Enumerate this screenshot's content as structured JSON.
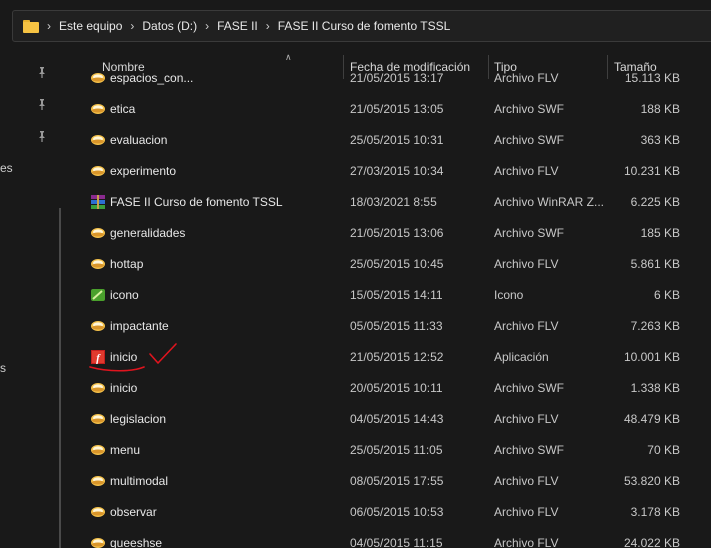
{
  "breadcrumbs": [
    "Este equipo",
    "Datos (D:)",
    "FASE II",
    "FASE II Curso de fomento TSSL"
  ],
  "nav_fragments": [
    "es",
    "s"
  ],
  "columns": {
    "name": "Nombre",
    "modified": "Fecha de modificación",
    "type": "Tipo",
    "size": "Tamaño"
  },
  "files": [
    {
      "name": "espacios_con...",
      "date": "21/05/2015 13:17",
      "type": "Archivo FLV",
      "size": "15.113 KB",
      "icon": "media-file-icon"
    },
    {
      "name": "etica",
      "date": "21/05/2015 13:05",
      "type": "Archivo SWF",
      "size": "188 KB",
      "icon": "media-file-icon"
    },
    {
      "name": "evaluacion",
      "date": "25/05/2015 10:31",
      "type": "Archivo SWF",
      "size": "363 KB",
      "icon": "media-file-icon"
    },
    {
      "name": "experimento",
      "date": "27/03/2015 10:34",
      "type": "Archivo FLV",
      "size": "10.231 KB",
      "icon": "media-file-icon"
    },
    {
      "name": "FASE II Curso de fomento TSSL",
      "date": "18/03/2021 8:55",
      "type": "Archivo WinRAR Z...",
      "size": "6.225 KB",
      "icon": "winrar-icon"
    },
    {
      "name": "generalidades",
      "date": "21/05/2015 13:06",
      "type": "Archivo SWF",
      "size": "185 KB",
      "icon": "media-file-icon"
    },
    {
      "name": "hottap",
      "date": "25/05/2015 10:45",
      "type": "Archivo FLV",
      "size": "5.861 KB",
      "icon": "media-file-icon"
    },
    {
      "name": "icono",
      "date": "15/05/2015 14:11",
      "type": "Icono",
      "size": "6 KB",
      "icon": "icon-file-icon"
    },
    {
      "name": "impactante",
      "date": "05/05/2015 11:33",
      "type": "Archivo FLV",
      "size": "7.263 KB",
      "icon": "media-file-icon"
    },
    {
      "name": "inicio",
      "date": "21/05/2015 12:52",
      "type": "Aplicación",
      "size": "10.001 KB",
      "icon": "flash-app-icon"
    },
    {
      "name": "inicio",
      "date": "20/05/2015 10:11",
      "type": "Archivo SWF",
      "size": "1.338 KB",
      "icon": "media-file-icon"
    },
    {
      "name": "legislacion",
      "date": "04/05/2015 14:43",
      "type": "Archivo FLV",
      "size": "48.479 KB",
      "icon": "media-file-icon"
    },
    {
      "name": "menu",
      "date": "25/05/2015 11:05",
      "type": "Archivo SWF",
      "size": "70 KB",
      "icon": "media-file-icon"
    },
    {
      "name": "multimodal",
      "date": "08/05/2015 17:55",
      "type": "Archivo FLV",
      "size": "53.820 KB",
      "icon": "media-file-icon"
    },
    {
      "name": "observar",
      "date": "06/05/2015 10:53",
      "type": "Archivo FLV",
      "size": "3.178 KB",
      "icon": "media-file-icon"
    },
    {
      "name": "queeshse",
      "date": "04/05/2015 11:15",
      "type": "Archivo FLV",
      "size": "24.022 KB",
      "icon": "media-file-icon"
    }
  ],
  "colors": {
    "background": "#191919",
    "annotation": "#e0141e",
    "folder": "#f6c343"
  }
}
